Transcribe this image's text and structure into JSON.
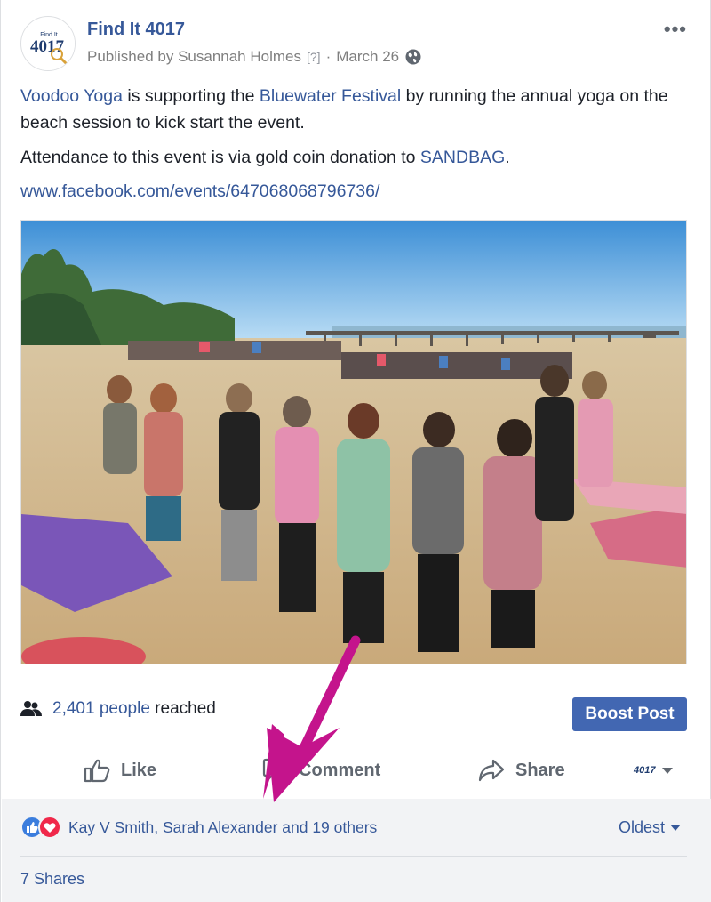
{
  "post": {
    "page_name": "Find It 4017",
    "published_by": "Published by Susannah Holmes",
    "help_marker": "[?]",
    "separator": "·",
    "date": "March 26",
    "logo_text": "4017",
    "logo_small": "Find It"
  },
  "body": {
    "line1_link1": "Voodoo Yoga",
    "line1_mid": " is supporting the ",
    "line1_link2": "Bluewater Festival",
    "line1_end": " by running the annual yoga on the beach session to kick start the event.",
    "line2_start": "Attendance to this event is via gold coin donation to ",
    "line2_link": "SANDBAG",
    "line2_end": ".",
    "url": "www.facebook.com/events/647068068796736/"
  },
  "insights": {
    "reached_count": "2,401 people",
    "reached_label": "reached",
    "boost_label": "Boost Post"
  },
  "actions": {
    "like": "Like",
    "comment": "Comment",
    "share": "Share",
    "page_selector": "4017"
  },
  "reactions": {
    "names": "Kay V Smith, Sarah Alexander and 19 others",
    "sort_label": "Oldest",
    "shares": "7 Shares"
  },
  "colors": {
    "link": "#365899",
    "boost": "#4267b2",
    "annotation_arrow": "#c4148c"
  },
  "icons": [
    "more-icon",
    "globe-icon",
    "people-icon",
    "like-icon",
    "comment-icon",
    "share-icon",
    "caret-down-icon",
    "like-reaction-icon",
    "love-reaction-icon"
  ]
}
